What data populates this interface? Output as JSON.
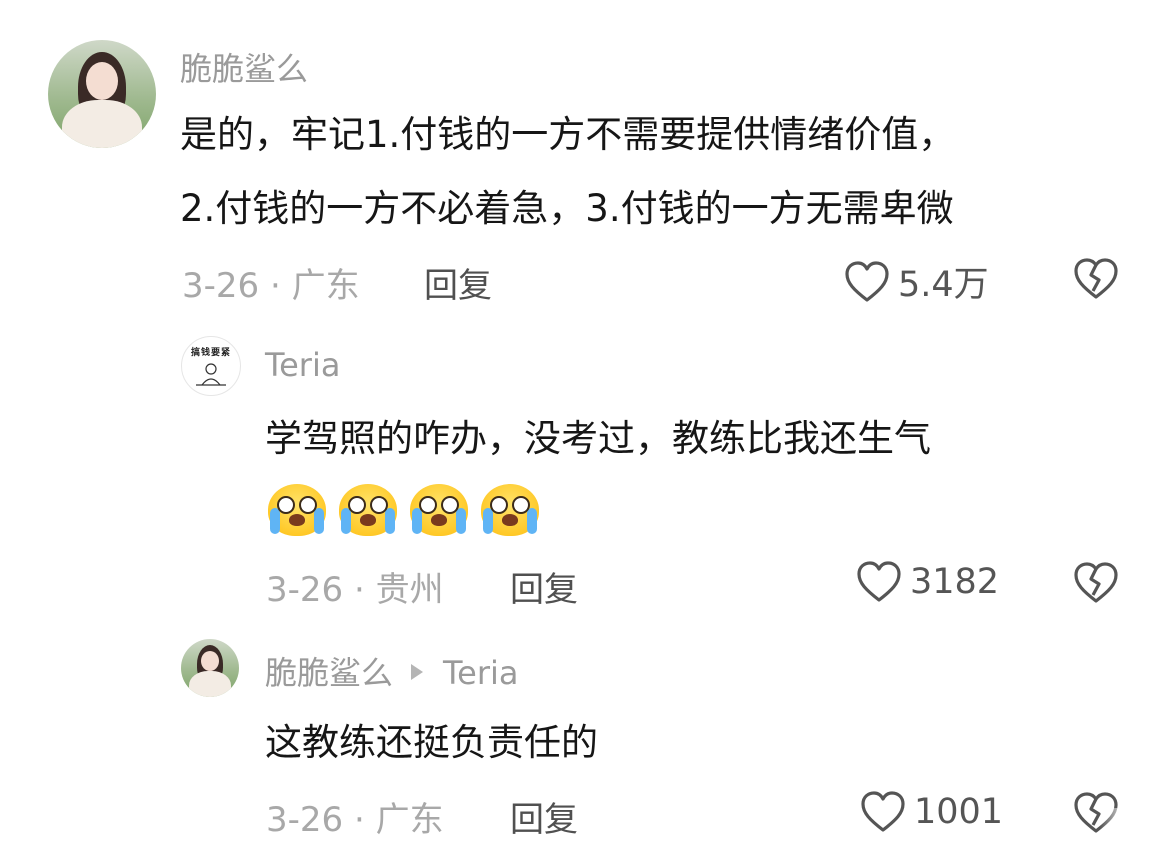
{
  "comments": [
    {
      "username": "脆脆鲨么",
      "text_lines": [
        "是的，牢记1.付钱的一方不需要提供情绪价值，",
        "2.付钱的一方不必着急，3.付钱的一方无需卑微"
      ],
      "date_location": "3-26 · 广东",
      "reply_label": "回复",
      "likes": "5.4万"
    },
    {
      "username": "Teria",
      "avatar_text": "搞钱要紧",
      "text_lines": [
        "学驾照的咋办，没考过，教练比我还生气"
      ],
      "emoji_count": 4,
      "emoji_icon": "crying-face-icon",
      "date_location": "3-26 · 贵州",
      "reply_label": "回复",
      "likes": "3182"
    },
    {
      "username": "脆脆鲨么",
      "reply_to": "Teria",
      "text_lines": [
        "这教练还挺负责任的"
      ],
      "date_location": "3-26 · 广东",
      "reply_label": "回复",
      "likes": "1001"
    }
  ],
  "colors": {
    "username": "#9a9a9a",
    "text": "#161616",
    "meta": "#a8a8a8",
    "reply": "#505050",
    "icon": "#555555"
  }
}
